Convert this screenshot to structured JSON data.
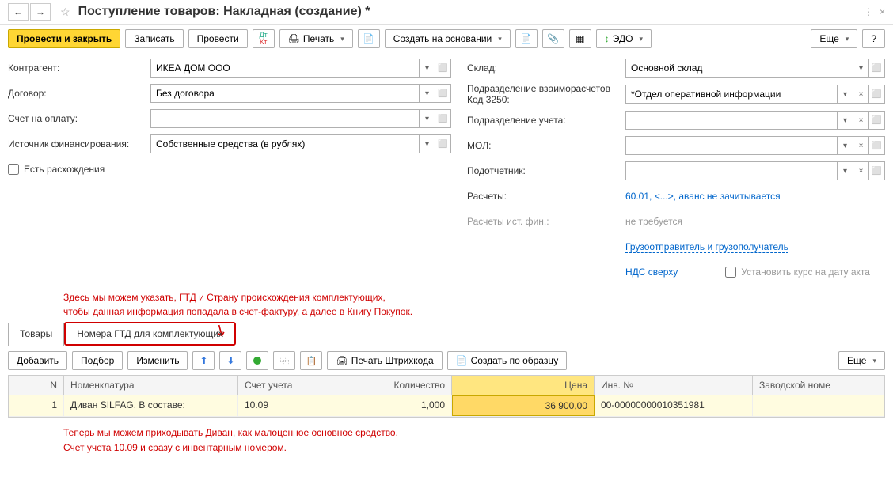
{
  "header": {
    "title": "Поступление товаров: Накладная (создание) *"
  },
  "toolbar": {
    "post_close": "Провести и закрыть",
    "write": "Записать",
    "post": "Провести",
    "print": "Печать",
    "create_based": "Создать на основании",
    "edo": "ЭДО",
    "more": "Еще",
    "help": "?"
  },
  "form": {
    "left": {
      "counterparty_lbl": "Контрагент:",
      "counterparty": "ИКЕА ДОМ ООО",
      "contract_lbl": "Договор:",
      "contract": "Без договора",
      "invoice_lbl": "Счет на оплату:",
      "invoice": "",
      "source_lbl": "Источник финансирования:",
      "source": "Собственные средства (в рублях)",
      "discrepancy": "Есть расхождения"
    },
    "right": {
      "warehouse_lbl": "Склад:",
      "warehouse": "Основной склад",
      "division_lbl": "Подразделение взаиморасчетов Код 3250:",
      "division": "*Отдел оперативной информации",
      "acc_division_lbl": "Подразделение учета:",
      "acc_division": "",
      "mol_lbl": "МОЛ:",
      "mol": "",
      "podot_lbl": "Подотчетник:",
      "podot": "",
      "calc_lbl": "Расчеты:",
      "calc": "60.01, <...>, аванс не зачитывается",
      "calc_fin_lbl": "Расчеты ист. фин.:",
      "calc_fin": "не требуется",
      "shipper": "Грузоотправитель и грузополучатель",
      "vat": "НДС сверху",
      "rate_chk": "Установить курс на дату акта"
    }
  },
  "annotations": {
    "a1_l1": "Здесь мы можем указать, ГТД и Страну происхождения комплектующих,",
    "a1_l2": "чтобы данная информация попадала в счет-фактуру, а далее в Книгу Покупок.",
    "a2_l1": "Теперь мы можем приходывать Диван, как малоценное основное средство.",
    "a2_l2": "Счет учета 10.09 и сразу с инвентарным номером."
  },
  "tabs": {
    "t1": "Товары",
    "t2": "Номера ГТД для комплектующих"
  },
  "grid_tb": {
    "add": "Добавить",
    "pick": "Подбор",
    "edit": "Изменить",
    "barcode": "Печать Штрихкода",
    "template": "Создать по образцу",
    "more": "Еще"
  },
  "grid": {
    "h_n": "N",
    "h_nom": "Номенклатура",
    "h_acc": "Счет учета",
    "h_qty": "Количество",
    "h_price": "Цена",
    "h_inv": "Инв. №",
    "h_zav": "Заводской номе",
    "r1": {
      "n": "1",
      "nom": "Диван SILFAG. В составе:",
      "acc": "10.09",
      "qty": "1,000",
      "price": "36 900,00",
      "inv": "00-00000000010351981",
      "zav": ""
    }
  }
}
